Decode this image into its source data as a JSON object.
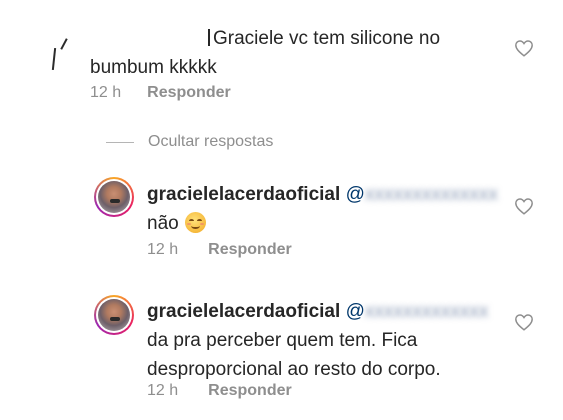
{
  "colors": {
    "text": "#262626",
    "meta": "#8e8e8e",
    "mention": "#00376b",
    "background": "#ffffff"
  },
  "icons": {
    "like": "heart-outline-icon",
    "avatar_ring": "story-ring",
    "emoji": "smiling-face-with-smiling-eyes"
  },
  "thread": {
    "comment": {
      "text_line1": "Graciele vc tem silicone no",
      "text_line2": "bumbum kkkkk",
      "time": "12 h",
      "reply_label": "Responder"
    },
    "hide_replies_label": "Ocultar respostas",
    "replies": [
      {
        "username": "gracielelacerdaoficial",
        "mention": "@",
        "mention_hidden": "xxxxxxxxxxxxxx",
        "text": "não",
        "emoji": "😊",
        "time": "12 h",
        "reply_label": "Responder"
      },
      {
        "username": "gracielelacerdaoficial",
        "mention": "@",
        "mention_hidden": "xxxxxxxxxxxxx",
        "text_line1": "da pra perceber quem tem. Fica",
        "text_line2": "desproporcional ao resto do corpo.",
        "time": "12 h",
        "reply_label": "Responder"
      }
    ]
  }
}
